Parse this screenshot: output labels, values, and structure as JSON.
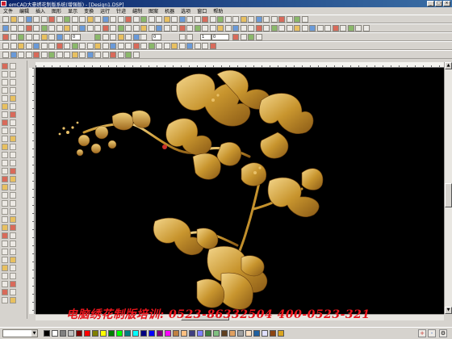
{
  "window": {
    "title": "emCAD大豪绣花制版系统(增强版) - [Design1.DSP]",
    "controls": [
      "_",
      "□",
      "×"
    ]
  },
  "menu": [
    "文件",
    "编辑",
    "插入",
    "图形",
    "显示",
    "变换",
    "运行",
    "针迹",
    "缝制",
    "图案",
    "机器",
    "选项",
    "窗口",
    "帮助"
  ],
  "toolbar": {
    "fields": [
      "0",
      "0",
      "0",
      "1",
      "0",
      "0",
      "0"
    ]
  },
  "watermark": "电脑绣花制版培训:  0523-86332504   400-0523-321",
  "status": {
    "select_value": "",
    "palette": [
      "#000000",
      "#ffffff",
      "#808080",
      "#c0c0c0",
      "#800000",
      "#ff0000",
      "#808000",
      "#ffff00",
      "#008000",
      "#00ff00",
      "#008080",
      "#00ffff",
      "#000080",
      "#0000ff",
      "#800080",
      "#ff00ff",
      "#c08040",
      "#ffc080",
      "#404080",
      "#8080ff",
      "#408040",
      "#80c080",
      "#604020",
      "#e0a060",
      "#a0a0a0",
      "#ffe0c0",
      "#2060a0",
      "#e0e0ff",
      "#8b4513",
      "#daa520"
    ],
    "add_label": "+",
    "remove_label": "-"
  }
}
